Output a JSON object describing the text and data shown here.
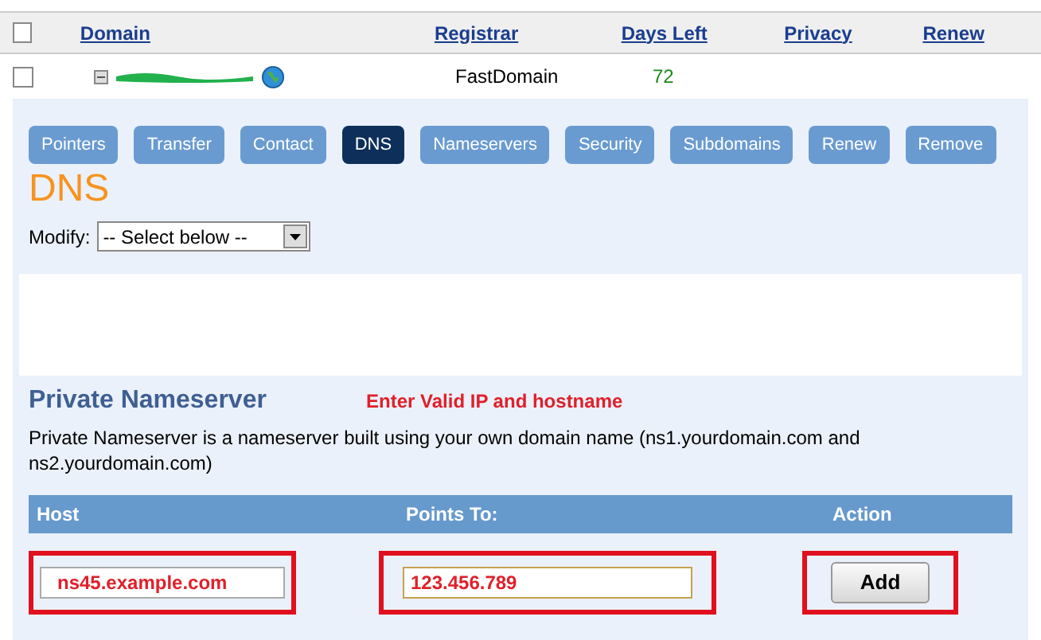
{
  "table": {
    "select_all_checked": false,
    "columns": [
      "Domain",
      "Registrar",
      "Days Left",
      "Privacy",
      "Renew"
    ],
    "rows": [
      {
        "checked": false,
        "registrar": "FastDomain",
        "days_left": "72"
      }
    ]
  },
  "tabs": [
    {
      "label": "Pointers",
      "selected": false
    },
    {
      "label": "Transfer",
      "selected": false
    },
    {
      "label": "Contact",
      "selected": false
    },
    {
      "label": "DNS",
      "selected": true
    },
    {
      "label": "Nameservers",
      "selected": false
    },
    {
      "label": "Security",
      "selected": false
    },
    {
      "label": "Subdomains",
      "selected": false
    },
    {
      "label": "Renew",
      "selected": false
    },
    {
      "label": "Remove",
      "selected": false
    }
  ],
  "page_title": "DNS",
  "modify": {
    "label": "Modify:",
    "value": "-- Select below --"
  },
  "private_nameserver": {
    "title": "Private Nameserver",
    "annotation": "Enter Valid IP and hostname",
    "description": "Private Nameserver is a nameserver built using your own domain name (ns1.yourdomain.com and ns2.yourdomain.com)",
    "columns": [
      "Host",
      "Points To:",
      "Action"
    ],
    "host": "ns45.example.com",
    "points_to": "123.456.789",
    "button": "Add"
  }
}
